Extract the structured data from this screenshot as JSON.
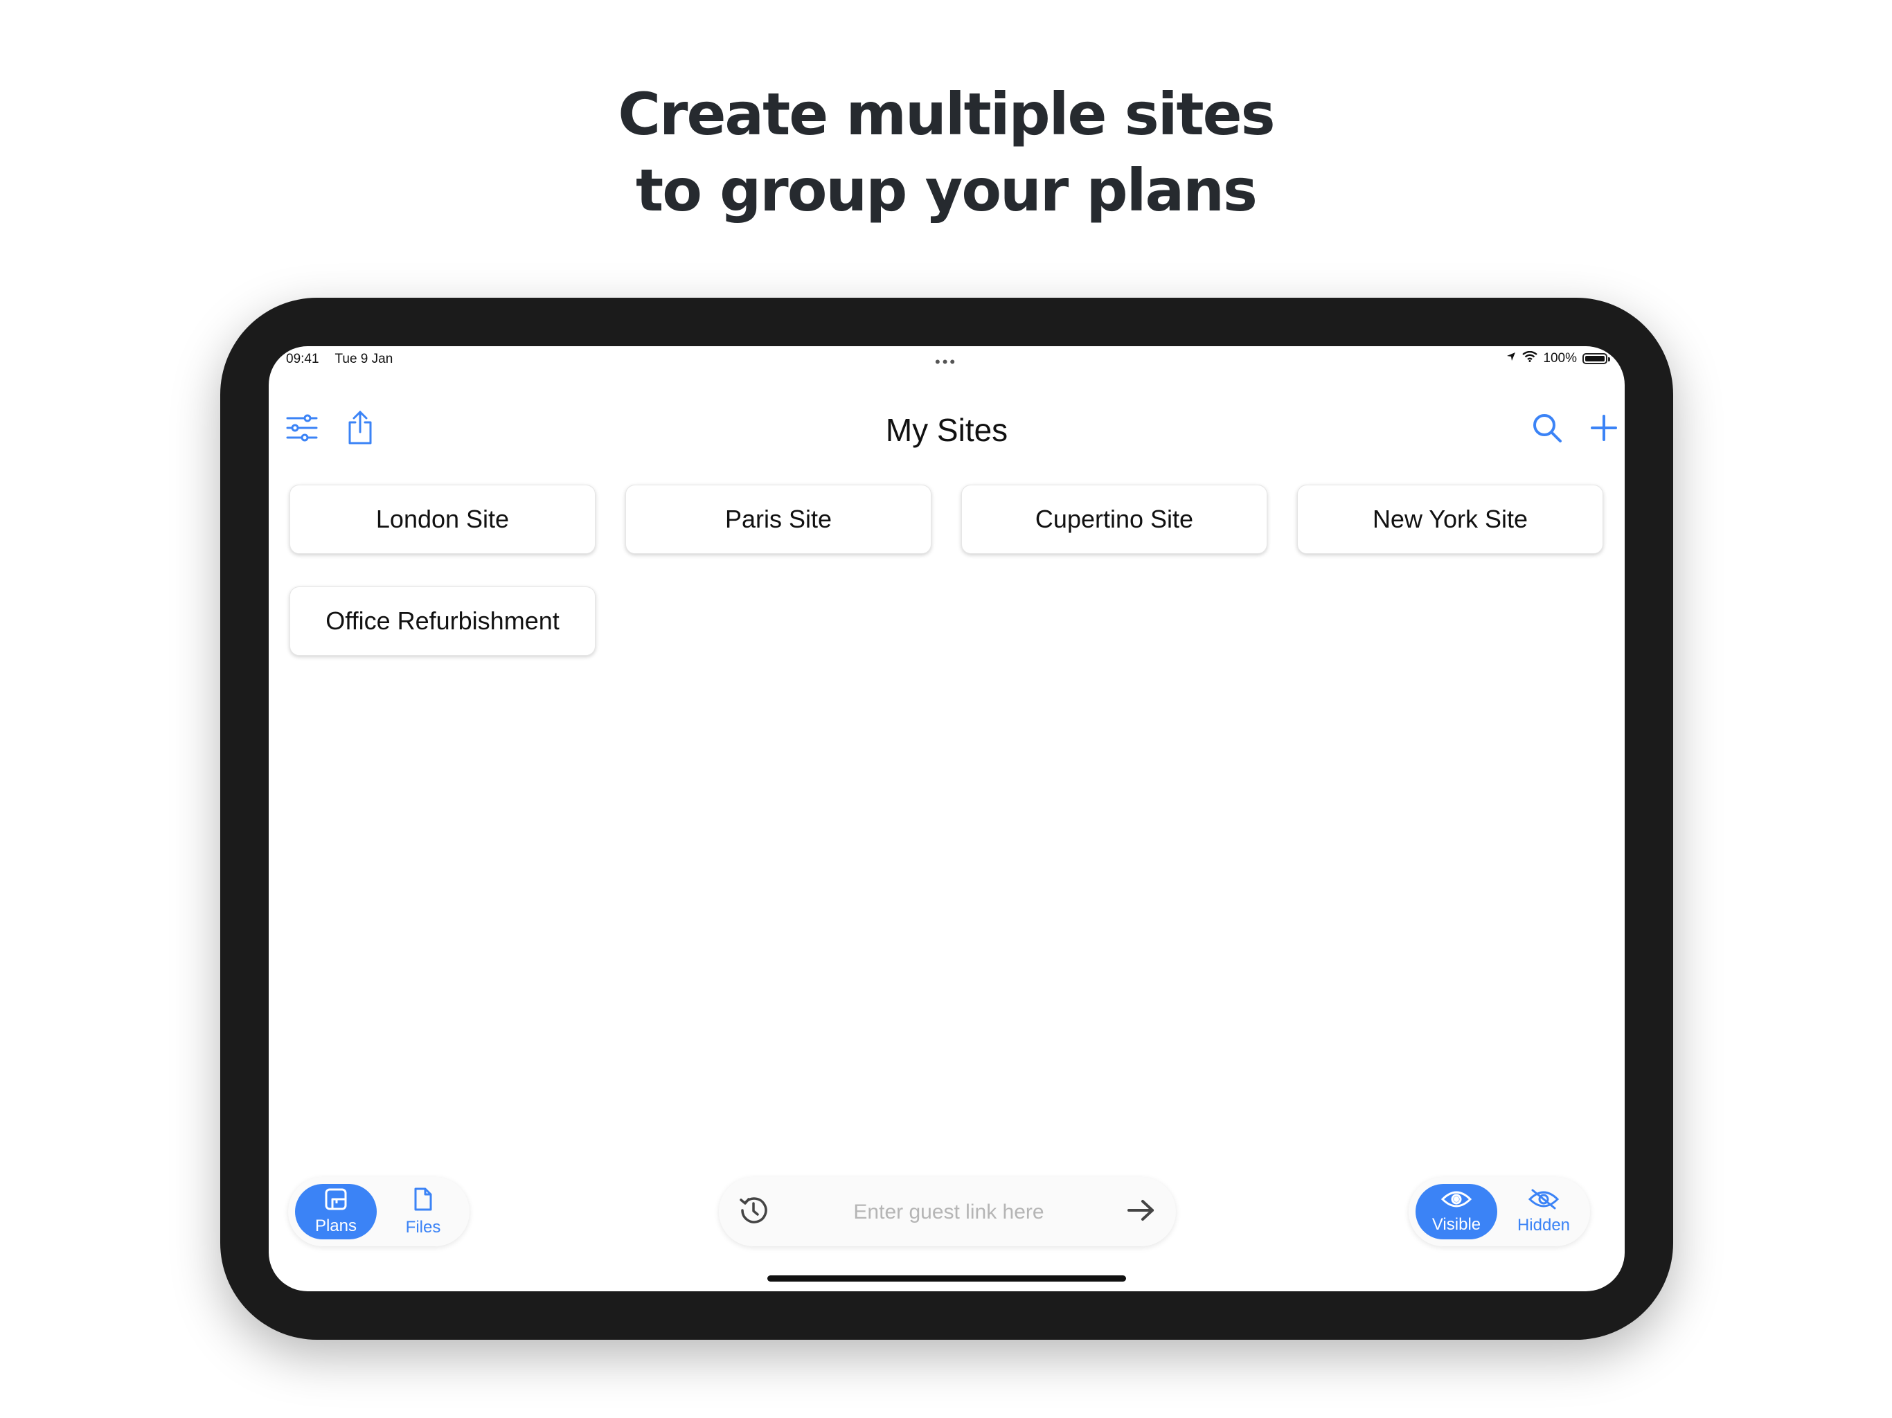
{
  "headline": {
    "line1": "Create multiple sites",
    "line2": "to group your plans"
  },
  "status_bar": {
    "time": "09:41",
    "date": "Tue 9 Jan",
    "battery": "100%"
  },
  "nav": {
    "title": "My Sites",
    "left_icons": [
      "sliders-icon",
      "share-icon"
    ],
    "right_icons": [
      "search-icon",
      "plus-icon"
    ]
  },
  "sites": [
    {
      "label": "London Site"
    },
    {
      "label": "Paris Site"
    },
    {
      "label": "Cupertino Site"
    },
    {
      "label": "New York Site"
    },
    {
      "label": "Office Refurbishment"
    }
  ],
  "tabs": {
    "plans": {
      "label": "Plans",
      "active": true
    },
    "files": {
      "label": "Files",
      "active": false
    }
  },
  "guest_link": {
    "placeholder": "Enter guest link here",
    "value": ""
  },
  "visibility": {
    "visible": {
      "label": "Visible",
      "active": true
    },
    "hidden": {
      "label": "Hidden",
      "active": false
    }
  },
  "colors": {
    "accent": "#3b83f6",
    "headline": "#262a2f",
    "device": "#1b1b1b"
  }
}
